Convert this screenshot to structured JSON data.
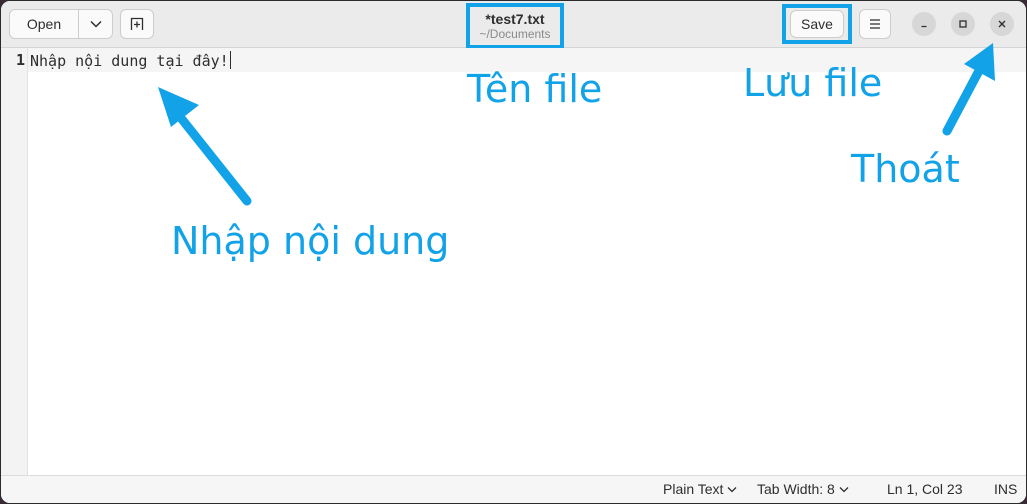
{
  "header": {
    "open_label": "Open",
    "title": "*test7.txt",
    "subtitle": "~/Documents",
    "save_label": "Save"
  },
  "editor": {
    "line_number": "1",
    "content": "Nhập nội dung tại đây!"
  },
  "statusbar": {
    "language": "Plain Text",
    "tab_width": "Tab Width: 8",
    "position": "Ln 1, Col 23",
    "mode": "INS"
  },
  "annotations": {
    "filename": "Tên file",
    "save": "Lưu file",
    "exit": "Thoát",
    "input": "Nhập nội dung",
    "color": "#12a2e8"
  },
  "icons": {
    "open_menu": "chevron-down-icon",
    "new_tab": "new-tab-icon",
    "menu": "hamburger-menu-icon",
    "minimize": "minimize-icon",
    "maximize": "maximize-icon",
    "close": "close-icon"
  }
}
